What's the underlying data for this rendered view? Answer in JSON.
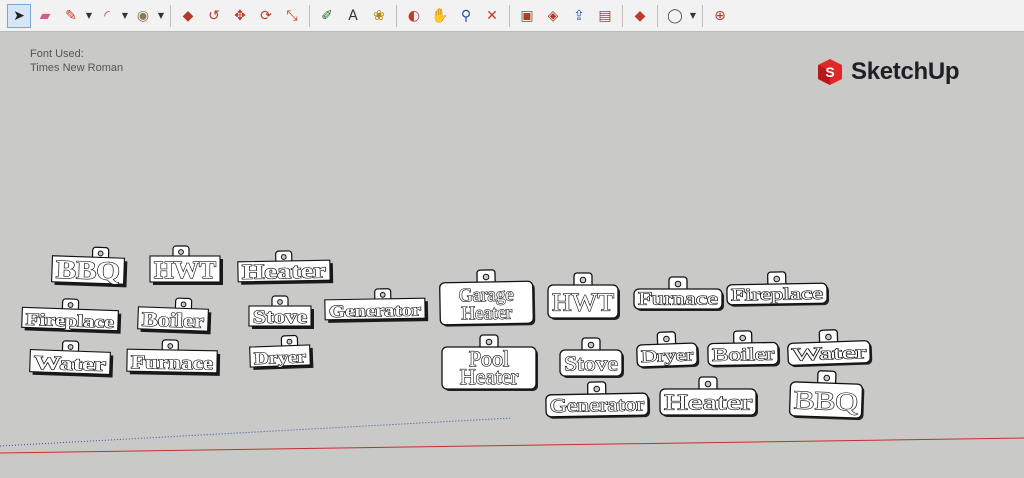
{
  "toolbar": {
    "tools": [
      {
        "name": "select-tool-button",
        "icon": "cursor-icon",
        "glyph": "➤",
        "color": "#222222",
        "active": true
      },
      {
        "name": "eraser-tool-button",
        "icon": "eraser-icon",
        "glyph": "▰",
        "color": "#d65a8c"
      },
      {
        "name": "pencil-tool-button",
        "icon": "pencil-icon",
        "glyph": "✎",
        "color": "#c0392b",
        "dropdown": true
      },
      {
        "name": "arc-tool-button",
        "icon": "arc-icon",
        "glyph": "◜",
        "color": "#c0392b",
        "dropdown": true
      },
      {
        "name": "paint-bucket-button",
        "icon": "paint-bucket-icon",
        "glyph": "◉",
        "color": "#8a7a55",
        "dropdown": true
      },
      {
        "sep": true
      },
      {
        "name": "push-pull-button",
        "icon": "push-pull-icon",
        "glyph": "◆",
        "color": "#b23a2a"
      },
      {
        "name": "follow-me-button",
        "icon": "follow-me-icon",
        "glyph": "↺",
        "color": "#c0392b"
      },
      {
        "name": "move-tool-button",
        "icon": "move-icon",
        "glyph": "✥",
        "color": "#c0392b"
      },
      {
        "name": "rotate-tool-button",
        "icon": "rotate-icon",
        "glyph": "⟳",
        "color": "#c0392b"
      },
      {
        "name": "scale-tool-button",
        "icon": "scale-icon",
        "glyph": "⤡",
        "color": "#c0392b"
      },
      {
        "sep": true
      },
      {
        "name": "tape-measure-button",
        "icon": "tape-measure-icon",
        "glyph": "✐",
        "color": "#2c6e2c"
      },
      {
        "name": "text-tool-button",
        "icon": "text-icon",
        "glyph": "A",
        "color": "#333333"
      },
      {
        "name": "paint-tool-button",
        "icon": "paint-icon",
        "glyph": "❀",
        "color": "#b8860b"
      },
      {
        "sep": true
      },
      {
        "name": "orbit-tool-button",
        "icon": "orbit-icon",
        "glyph": "◐",
        "color": "#c0392b"
      },
      {
        "name": "pan-tool-button",
        "icon": "hand-icon",
        "glyph": "✋",
        "color": "#c9a227"
      },
      {
        "name": "zoom-tool-button",
        "icon": "zoom-icon",
        "glyph": "⚲",
        "color": "#1f4e9e"
      },
      {
        "name": "zoom-extents-button",
        "icon": "zoom-extents-icon",
        "glyph": "✕",
        "color": "#c0392b"
      },
      {
        "sep": true
      },
      {
        "name": "warehouse-button",
        "icon": "warehouse-icon",
        "glyph": "▣",
        "color": "#b23a2a"
      },
      {
        "name": "components-button",
        "icon": "components-icon",
        "glyph": "◈",
        "color": "#b23a2a"
      },
      {
        "name": "share-model-button",
        "icon": "share-icon",
        "glyph": "⇪",
        "color": "#2a5fb2"
      },
      {
        "name": "extension-warehouse-button",
        "icon": "extension-icon",
        "glyph": "▤",
        "color": "#b23a2a"
      },
      {
        "sep": true
      },
      {
        "name": "ruby-console-button",
        "icon": "ruby-icon",
        "glyph": "◆",
        "color": "#c0392b"
      },
      {
        "sep": true
      },
      {
        "name": "account-button",
        "icon": "user-icon",
        "glyph": "◯",
        "color": "#555555",
        "dropdown": true
      },
      {
        "sep": true
      },
      {
        "name": "model-info-button",
        "icon": "globe-icon",
        "glyph": "⊕",
        "color": "#b23a2a"
      }
    ]
  },
  "note": {
    "line1": "Font Used:",
    "line2": "Times New Roman"
  },
  "logo": {
    "text": "SketchUp",
    "color": "#e02828"
  },
  "tags_left": [
    {
      "text": "BBQ"
    },
    {
      "text": "HWT"
    },
    {
      "text": "Heater"
    },
    {
      "text": "Fireplace"
    },
    {
      "text": "Boiler"
    },
    {
      "text": "Stove"
    },
    {
      "text": "Generator"
    },
    {
      "text": "Water"
    },
    {
      "text": "Furnace"
    },
    {
      "text": "Dryer"
    }
  ],
  "tags_right": [
    {
      "line1": "Garage",
      "line2": "Heater"
    },
    {
      "text": "HWT"
    },
    {
      "text": "Furnace"
    },
    {
      "text": "Fireplace"
    },
    {
      "line1": "Pool",
      "line2": "Heater"
    },
    {
      "text": "Stove"
    },
    {
      "text": "Dryer"
    },
    {
      "text": "Boiler"
    },
    {
      "text": "Water"
    },
    {
      "text": "Generator"
    },
    {
      "text": "Heater"
    },
    {
      "text": "BBQ"
    }
  ]
}
